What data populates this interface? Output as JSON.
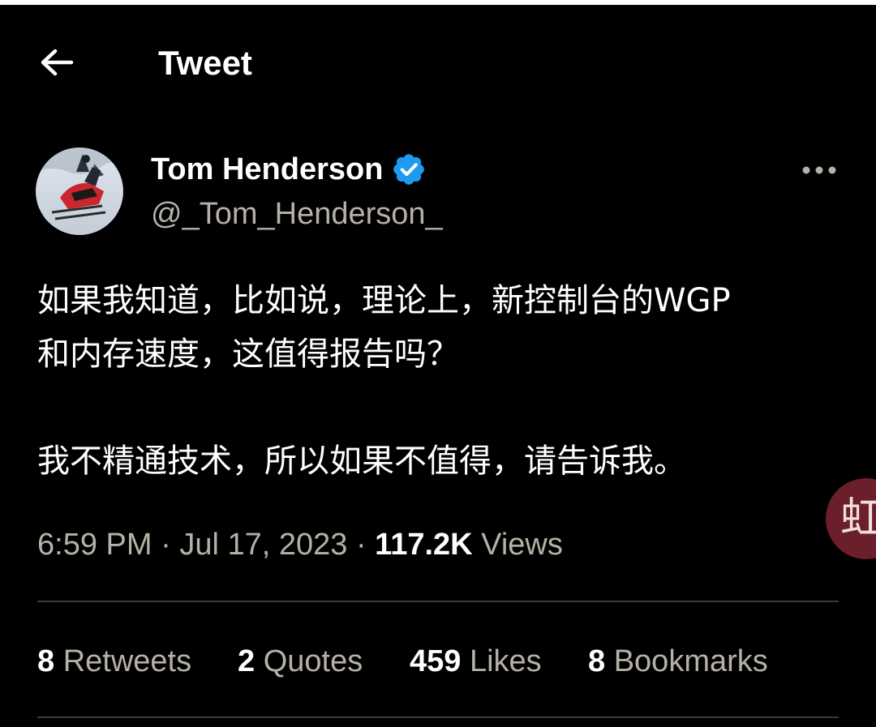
{
  "header": {
    "title": "Tweet",
    "back_icon": "arrow-left-icon"
  },
  "author": {
    "name": "Tom Henderson",
    "handle": "@_Tom_Henderson_",
    "verified": true,
    "verified_color": "#1d9bf0"
  },
  "tweet": {
    "paragraph1": "如果我知道，比如说，理论上，新控制台的WGP和内存速度，这值得报告吗？",
    "paragraph1_line1": "如果我知道，比如说，理论上，新控制台的WGP",
    "paragraph1_line2": "和内存速度，这值得报告吗？",
    "paragraph2": "我不精通技术，所以如果不值得，请告诉我。"
  },
  "meta": {
    "time": "6:59 PM",
    "separator": "·",
    "date": "Jul 17, 2023",
    "views_count": "117.2K",
    "views_label": "Views"
  },
  "stats": {
    "retweets": {
      "count": "8",
      "label": "Retweets"
    },
    "quotes": {
      "count": "2",
      "label": "Quotes"
    },
    "likes": {
      "count": "459",
      "label": "Likes"
    },
    "bookmarks": {
      "count": "8",
      "label": "Bookmarks"
    }
  },
  "floating_badge": {
    "text": "虹",
    "color": "#6b1f2a"
  },
  "colors": {
    "background": "#000000",
    "text_primary": "#ffffff",
    "text_secondary": "#b5b1a6",
    "divider": "#3a3a3a"
  }
}
